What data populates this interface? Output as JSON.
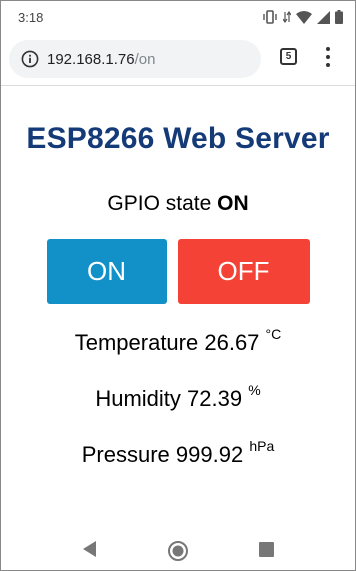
{
  "status_bar": {
    "time": "3:18",
    "icons": [
      "vibrate-icon",
      "data-icon",
      "wifi-icon",
      "signal-icon",
      "battery-icon"
    ]
  },
  "browser": {
    "url_host": "192.168.1.76",
    "url_path": "/on",
    "tab_count": "5"
  },
  "page": {
    "title": "ESP8266 Web Server",
    "gpio_label": "GPIO state",
    "gpio_state": "ON",
    "on_button": "ON",
    "off_button": "OFF",
    "temperature": {
      "label": "Temperature",
      "value": "26.67",
      "unit": "°C"
    },
    "humidity": {
      "label": "Humidity",
      "value": "72.39",
      "unit": "%"
    },
    "pressure": {
      "label": "Pressure",
      "value": "999.92",
      "unit": "hPa"
    }
  },
  "colors": {
    "title": "#143a78",
    "on_button": "#1290c8",
    "off_button": "#f44336"
  }
}
